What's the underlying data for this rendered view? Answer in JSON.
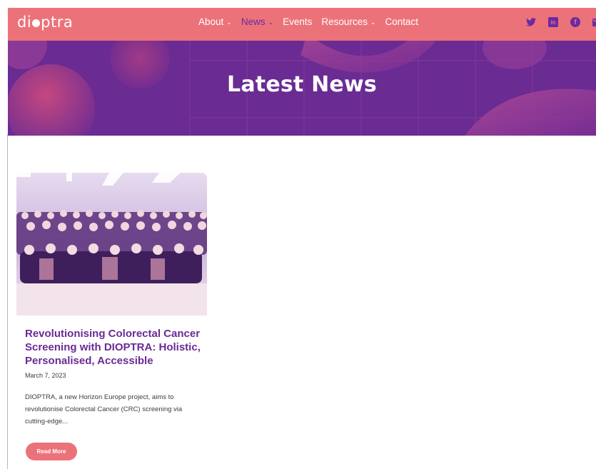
{
  "brand": {
    "logo_left": "di",
    "logo_right": "ptra",
    "primary": "#ec7279",
    "accent": "#6b2aa1"
  },
  "nav": {
    "items": [
      {
        "label": "About",
        "has_dropdown": true,
        "active": false
      },
      {
        "label": "News",
        "has_dropdown": true,
        "active": true
      },
      {
        "label": "Events",
        "has_dropdown": false,
        "active": false
      },
      {
        "label": "Resources",
        "has_dropdown": true,
        "active": false
      },
      {
        "label": "Contact",
        "has_dropdown": false,
        "active": false
      }
    ],
    "social_icons": [
      "twitter-icon",
      "linkedin-icon",
      "facebook-icon",
      "email-icon"
    ]
  },
  "hero": {
    "title": "Latest News"
  },
  "post": {
    "image": "group-photo",
    "title": "Revolutionising Colorectal Cancer Screening with DIOPTRA: Holistic, Personalised, Accessible",
    "date": "March 7, 2023",
    "excerpt": "DIOPTRA, a new Horizon Europe project, aims to revolutionise Colorectal Cancer (CRC) screening via cutting-edge...",
    "button_label": "Read More"
  }
}
